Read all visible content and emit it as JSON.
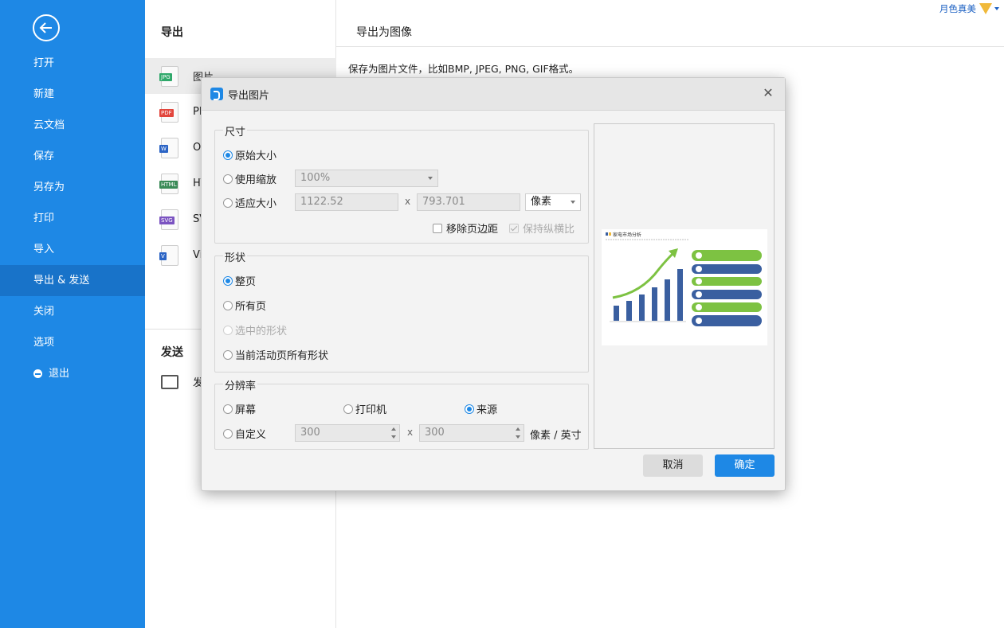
{
  "sidebar": {
    "items": [
      {
        "label": "打开"
      },
      {
        "label": "新建"
      },
      {
        "label": "云文档"
      },
      {
        "label": "保存"
      },
      {
        "label": "另存为"
      },
      {
        "label": "打印"
      },
      {
        "label": "导入"
      },
      {
        "label": "导出 & 发送"
      },
      {
        "label": "关闭"
      },
      {
        "label": "选项"
      },
      {
        "label": "退出"
      }
    ]
  },
  "middle": {
    "title": "导出",
    "formats": [
      {
        "label": "图片",
        "tag": "JPG",
        "tag_color": "#2fa86a"
      },
      {
        "label": "PDF",
        "tag": "PDF",
        "tag_color": "#e2463d"
      },
      {
        "label": "Office",
        "tag": "W",
        "tag_color": "#2b64c5"
      },
      {
        "label": "HTML",
        "tag": "HTML",
        "tag_color": "#3a8a57"
      },
      {
        "label": "SVG",
        "tag": "SVG",
        "tag_color": "#7b53c1"
      },
      {
        "label": "Visio",
        "tag": "V",
        "tag_color": "#2b64c5"
      }
    ],
    "send_title": "发送",
    "send_item": "发送邮件"
  },
  "right": {
    "title": "导出为图像",
    "description": "保存为图片文件，比如BMP, JPEG, PNG, GIF格式。",
    "username": "月色真美"
  },
  "dialog": {
    "title": "导出图片",
    "size_group": {
      "label": "尺寸",
      "original": "原始大小",
      "use_scale": "使用缩放",
      "scale_value": "100%",
      "fit_size": "适应大小",
      "width": "1122.52",
      "x": "x",
      "height": "793.701",
      "unit": "像素",
      "remove_margin": "移除页边距",
      "keep_ratio": "保持纵横比"
    },
    "shape_group": {
      "label": "形状",
      "whole_page": "整页",
      "all_pages": "所有页",
      "selected_shapes": "选中的形状",
      "active_page_shapes": "当前活动页所有形状"
    },
    "resolution_group": {
      "label": "分辨率",
      "screen": "屏幕",
      "printer": "打印机",
      "source": "来源",
      "custom": "自定义",
      "dpi_x": "300",
      "x": "x",
      "dpi_y": "300",
      "unit": "像素 / 英寸"
    },
    "preview": {
      "title": "家电市场分析"
    },
    "cancel": "取消",
    "ok": "确定"
  }
}
